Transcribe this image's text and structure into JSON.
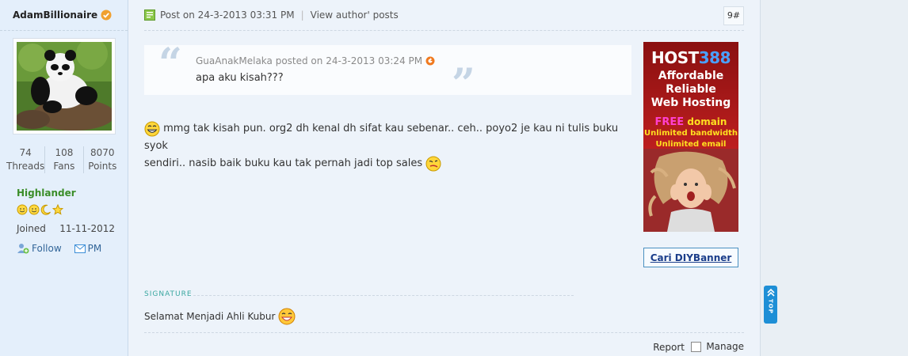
{
  "sidebar": {
    "author_name": "AdamBillionaire",
    "stats": [
      {
        "value": "74",
        "label": "Threads"
      },
      {
        "value": "108",
        "label": "Fans"
      },
      {
        "value": "8070",
        "label": "Points"
      }
    ],
    "rank": "Highlander",
    "joined_label": "Joined",
    "joined_date": "11-11-2012",
    "follow_label": "Follow",
    "pm_label": "PM"
  },
  "post": {
    "header_text": "Post on 24-3-2013 03:31 PM",
    "view_author_posts": "View author' posts",
    "floor": "9#",
    "quote": {
      "author_line": "GuaAnakMelaka posted on 24-3-2013 03:24 PM",
      "text": "apa aku kisah???"
    },
    "body_line1": "mmg tak kisah pun. org2 dh kenal dh sifat kau sebenar.. ceh.. poyo2 je kau ni tulis buku syok",
    "body_line2": "sendiri.. nasib baik buku kau tak pernah jadi top sales",
    "signature_label": "SIGNATURE",
    "signature_text": "Selamat Menjadi Ahli Kubur",
    "report_label": "Report",
    "manage_label": "Manage"
  },
  "ad": {
    "brand_text": "HOST",
    "brand_number": "388",
    "line1": "Affordable",
    "line2": "Reliable",
    "line3": "Web Hosting",
    "free": "FREE",
    "domain": "domain",
    "unlimited1": "Unlimited bandwidth",
    "unlimited2": "Unlimited email",
    "cta": "Cari DIYBanner"
  },
  "top_button": "TOP",
  "colors": {
    "sidebar_bg": "#e4effb",
    "main_bg": "#edf3fa",
    "rank_color": "#3a8d28",
    "link_color": "#336699",
    "top_button_bg": "#1e8fd6"
  }
}
